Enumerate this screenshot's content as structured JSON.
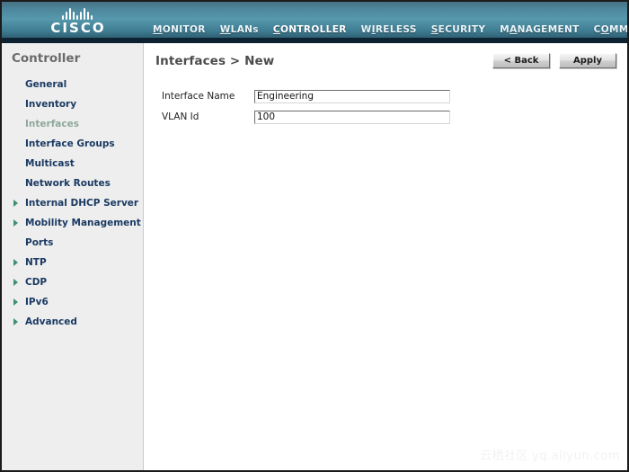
{
  "header": {
    "logo": {
      "wordmark": "CISCO",
      "bars": [
        5,
        9,
        13,
        9,
        5,
        9,
        13,
        9,
        5
      ]
    },
    "nav": [
      {
        "label": "MONITOR",
        "accel": "M",
        "active": false
      },
      {
        "label": "WLANs",
        "accel": "W",
        "active": false
      },
      {
        "label": "CONTROLLER",
        "accel": "C",
        "active": true
      },
      {
        "label": "WIRELESS",
        "accel": "I",
        "active": false
      },
      {
        "label": "SECURITY",
        "accel": "S",
        "active": false
      },
      {
        "label": "MANAGEMENT",
        "accel": "A",
        "active": false
      },
      {
        "label": "COMMANDS",
        "accel": "O",
        "active": false
      }
    ],
    "accent_color": "#e8921e"
  },
  "sidebar": {
    "title": "Controller",
    "items": [
      {
        "label": "General",
        "expandable": false,
        "current": false
      },
      {
        "label": "Inventory",
        "expandable": false,
        "current": false
      },
      {
        "label": "Interfaces",
        "expandable": false,
        "current": true
      },
      {
        "label": "Interface Groups",
        "expandable": false,
        "current": false
      },
      {
        "label": "Multicast",
        "expandable": false,
        "current": false
      },
      {
        "label": "Network Routes",
        "expandable": false,
        "current": false
      },
      {
        "label": "Internal DHCP Server",
        "expandable": true,
        "current": false
      },
      {
        "label": "Mobility Management",
        "expandable": true,
        "current": false
      },
      {
        "label": "Ports",
        "expandable": false,
        "current": false
      },
      {
        "label": "NTP",
        "expandable": true,
        "current": false
      },
      {
        "label": "CDP",
        "expandable": true,
        "current": false
      },
      {
        "label": "IPv6",
        "expandable": true,
        "current": false
      },
      {
        "label": "Advanced",
        "expandable": true,
        "current": false
      }
    ]
  },
  "content": {
    "page_title": "Interfaces > New",
    "buttons": {
      "back": "< Back",
      "apply": "Apply"
    },
    "form": {
      "fields": [
        {
          "label": "Interface Name",
          "value": "Engineering"
        },
        {
          "label": "VLAN Id",
          "value": "100"
        }
      ]
    }
  },
  "watermark": {
    "cn": "云栖社区",
    "url": "yq.aliyun.com"
  }
}
